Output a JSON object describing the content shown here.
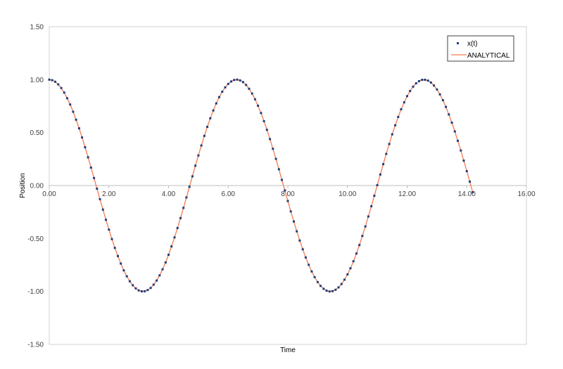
{
  "chart_data": {
    "type": "scatter",
    "title": "",
    "xlabel": "Time",
    "ylabel": "Position",
    "xlim": [
      0,
      16
    ],
    "ylim": [
      -1.5,
      1.5
    ],
    "x_ticks": [
      "0.00",
      "2.00",
      "4.00",
      "6.00",
      "8.00",
      "10.00",
      "12.00",
      "14.00",
      "16.00"
    ],
    "y_ticks": [
      "1.50",
      "1.00",
      "0.50",
      "0.00",
      "-0.50",
      "-1.00",
      "-1.50"
    ],
    "grid": false,
    "legend_position": "top-right",
    "t_start": 0,
    "t_step": 0.1,
    "series": [
      {
        "name": "x(t)",
        "kind": "markers",
        "color": "#1f3d7a",
        "values": [
          1.0,
          0.995,
          0.98,
          0.955,
          0.921,
          0.878,
          0.825,
          0.765,
          0.697,
          0.622,
          0.54,
          0.454,
          0.362,
          0.267,
          0.17,
          0.071,
          -0.029,
          -0.129,
          -0.227,
          -0.323,
          -0.416,
          -0.505,
          -0.589,
          -0.666,
          -0.737,
          -0.801,
          -0.857,
          -0.904,
          -0.942,
          -0.971,
          -0.99,
          -0.999,
          -0.998,
          -0.987,
          -0.967,
          -0.936,
          -0.897,
          -0.848,
          -0.791,
          -0.726,
          -0.654,
          -0.575,
          -0.49,
          -0.401,
          -0.307,
          -0.211,
          -0.112,
          -0.012,
          0.087,
          0.187,
          0.284,
          0.378,
          0.469,
          0.554,
          0.635,
          0.709,
          0.776,
          0.835,
          0.886,
          0.927,
          0.96,
          0.983,
          0.997,
          1.0,
          0.993,
          0.977,
          0.95,
          0.914,
          0.869,
          0.815,
          0.754,
          0.685,
          0.608,
          0.526,
          0.439,
          0.347,
          0.252,
          0.154,
          0.054,
          -0.046,
          -0.146,
          -0.244,
          -0.339,
          -0.432,
          -0.519,
          -0.602,
          -0.679,
          -0.749,
          -0.811,
          -0.865,
          -0.911,
          -0.948,
          -0.975,
          -0.993,
          -1.0,
          -0.997,
          -0.984,
          -0.962,
          -0.93,
          -0.889,
          -0.839,
          -0.781,
          -0.715,
          -0.642,
          -0.562,
          -0.476,
          -0.386,
          -0.292,
          -0.195,
          -0.096,
          0.004,
          0.104,
          0.202,
          0.299,
          0.392,
          0.484,
          0.569,
          0.648,
          0.721,
          0.786,
          0.844,
          0.893,
          0.934,
          0.965,
          0.986,
          0.998,
          0.999,
          0.991,
          0.973,
          0.945,
          0.907,
          0.861,
          0.806,
          0.743,
          0.672,
          0.594,
          0.511,
          0.423,
          0.331,
          0.235,
          0.136,
          0.037,
          -0.063
        ]
      },
      {
        "name": "ANALYTICAL",
        "kind": "line",
        "color": "#f47a50",
        "same_as": "x(t)"
      }
    ]
  }
}
